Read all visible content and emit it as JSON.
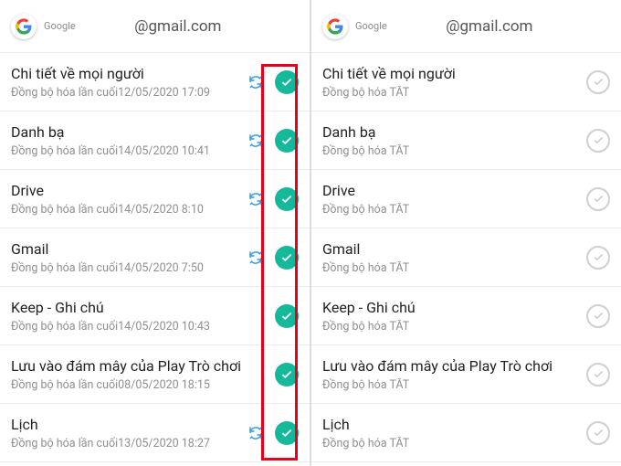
{
  "header": {
    "provider": "Google",
    "email": "@gmail.com"
  },
  "sync_prefix": "Đồng bộ hóa lần cuối",
  "sync_off_text": "Đồng bộ hóa TẮT",
  "colors": {
    "accent_on": "#16b89c",
    "sync_blue": "#2aa0e6",
    "highlight": "#e6001a"
  },
  "left": {
    "items": [
      {
        "title": "Chi tiết về mọi người",
        "sub": "Đồng bộ hóa lần cuối12/05/2020 17:09",
        "syncing": true,
        "on": true
      },
      {
        "title": "Danh bạ",
        "sub": "Đồng bộ hóa lần cuối14/05/2020 10:41",
        "syncing": true,
        "on": true
      },
      {
        "title": "Drive",
        "sub": "Đồng bộ hóa lần cuối14/05/2020 8:10",
        "syncing": true,
        "on": true
      },
      {
        "title": "Gmail",
        "sub": "Đồng bộ hóa lần cuối14/05/2020 7:50",
        "syncing": true,
        "on": true
      },
      {
        "title": "Keep - Ghi chú",
        "sub": "Đồng bộ hóa lần cuối14/05/2020 10:43",
        "syncing": false,
        "on": true
      },
      {
        "title": "Lưu vào đám mây của Play Trò chơi",
        "sub": "Đồng bộ hóa lần cuối08/05/2020 18:15",
        "syncing": false,
        "on": true
      },
      {
        "title": "Lịch",
        "sub": "Đồng bộ hóa lần cuối13/05/2020 18:27",
        "syncing": true,
        "on": true
      }
    ]
  },
  "right": {
    "items": [
      {
        "title": "Chi tiết về mọi người",
        "sub": "Đồng bộ hóa TẮT",
        "on": false
      },
      {
        "title": "Danh bạ",
        "sub": "Đồng bộ hóa TẮT",
        "on": false
      },
      {
        "title": "Drive",
        "sub": "Đồng bộ hóa TẮT",
        "on": false
      },
      {
        "title": "Gmail",
        "sub": "Đồng bộ hóa TẮT",
        "on": false
      },
      {
        "title": "Keep - Ghi chú",
        "sub": "Đồng bộ hóa TẮT",
        "on": false
      },
      {
        "title": "Lưu vào đám mây của Play Trò chơi",
        "sub": "Đồng bộ hóa TẮT",
        "on": false
      },
      {
        "title": "Lịch",
        "sub": "Đồng bộ hóa TẮT",
        "on": false
      }
    ]
  }
}
